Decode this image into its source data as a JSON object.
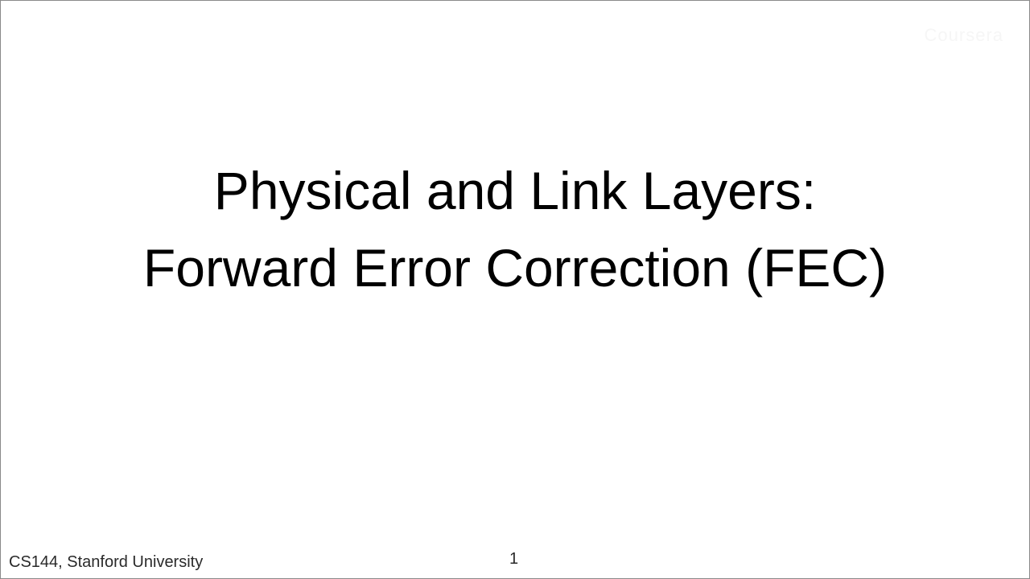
{
  "slide": {
    "watermark": "Coursera",
    "title_line_1": "Physical and Link Layers:",
    "title_line_2": "Forward Error Correction (FEC)",
    "footer": "CS144, Stanford University",
    "page_number": "1"
  }
}
